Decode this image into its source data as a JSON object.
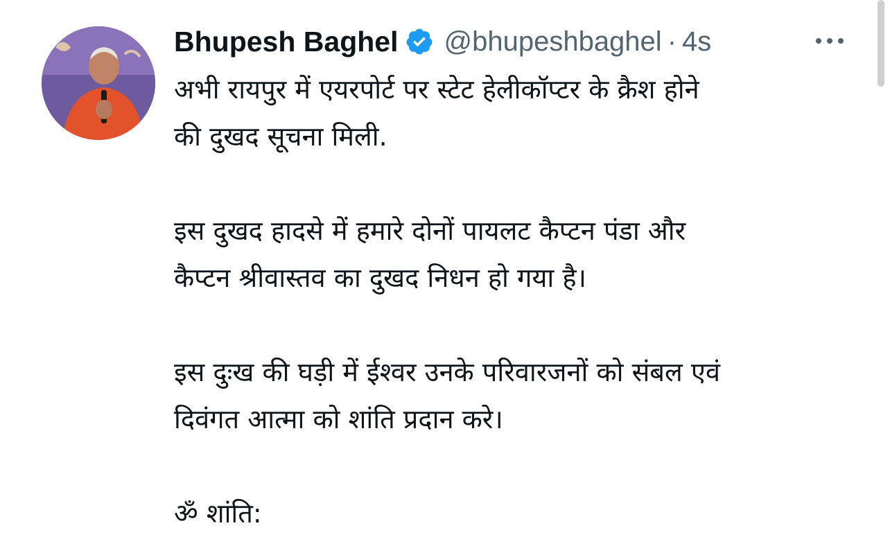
{
  "tweet": {
    "display_name": "Bhupesh Baghel",
    "handle": "@bhupeshbaghel",
    "separator": "·",
    "time": "4s",
    "paragraphs": [
      "अभी रायपुर में एयरपोर्ट पर स्टेट हेलीकॉप्टर के क्रैश होने\nकी दुखद सूचना मिली.",
      "इस दुखद हादसे में हमारे दोनों पायलट कैप्टन पंडा और\nकैप्टन श्रीवास्तव का दुखद निधन हो गया है।",
      "इस दुःख की घड़ी में ईश्वर उनके परिवारजनों को संबल एवं\nदिवंगत आत्मा को शांति प्रदान करे।",
      "ॐ शांति:"
    ],
    "icons": {
      "verified": "verified-badge-icon",
      "more": "more-options-icon"
    }
  },
  "colors": {
    "text": "#0f1419",
    "secondary": "#536471",
    "verified": "#1d9bf0"
  }
}
